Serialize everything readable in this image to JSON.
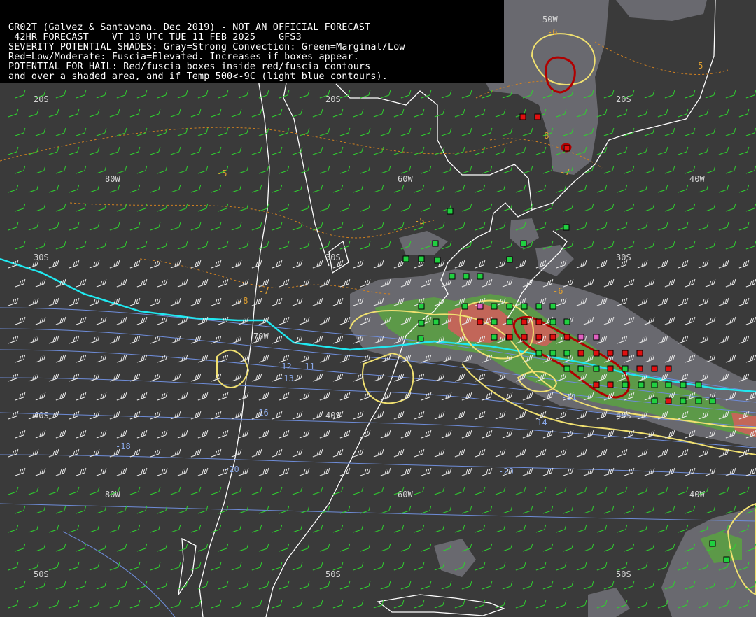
{
  "header": {
    "line1": "GR02T (Galvez & Santavana. Dec 2019) - NOT AN OFFICIAL FORECAST",
    "line2": " 42HR FORECAST    VT 18 UTC TUE 11 FEB 2025    GFS3",
    "line3": "SEVERITY POTENTIAL SHADES: Gray=Strong Convection: Green=Marginal/Low",
    "line4": "Red=Low/Moderate: Fuscia=Elevated. Increases if boxes appear.",
    "line5": "POTENTIAL FOR HAIL: Red/fuscia boxes inside red/fuscia contours",
    "line6": "and over a shaded area, and if Temp 500<-9C (light blue contours)."
  },
  "graticule": {
    "lat": [
      "20S",
      "30S",
      "40S",
      "50S"
    ],
    "lon": [
      "80W",
      "70W",
      "60W",
      "50W",
      "40W"
    ]
  },
  "contour_labels": {
    "temperature_500": [
      "-5",
      "-5",
      "-5",
      "-6",
      "-6",
      "-7",
      "-7",
      "-8",
      "-8"
    ],
    "blue": [
      "-12",
      "-11",
      "-13",
      "-11",
      "-16",
      "-18",
      "-14",
      "-20",
      "-20"
    ]
  },
  "colors": {
    "background": "#3a3a3a",
    "header": "#000000",
    "coast": "#ffffff",
    "gray_shade": "#6e6e74",
    "green_shade": "#5c9c46",
    "red_shade": "#c8645a",
    "fuscia": "#e060c0",
    "yellow_contour": "#f0e070",
    "cyan_line": "#20e8f0",
    "blue_contour": "#6e8cd8",
    "orange_dash": "#d08020",
    "dark_red_contour": "#b00000",
    "box_green": "#20d040",
    "box_red": "#e01010",
    "wind_barb_green": "#30d030",
    "wind_barb_white": "#e8e8e8"
  }
}
